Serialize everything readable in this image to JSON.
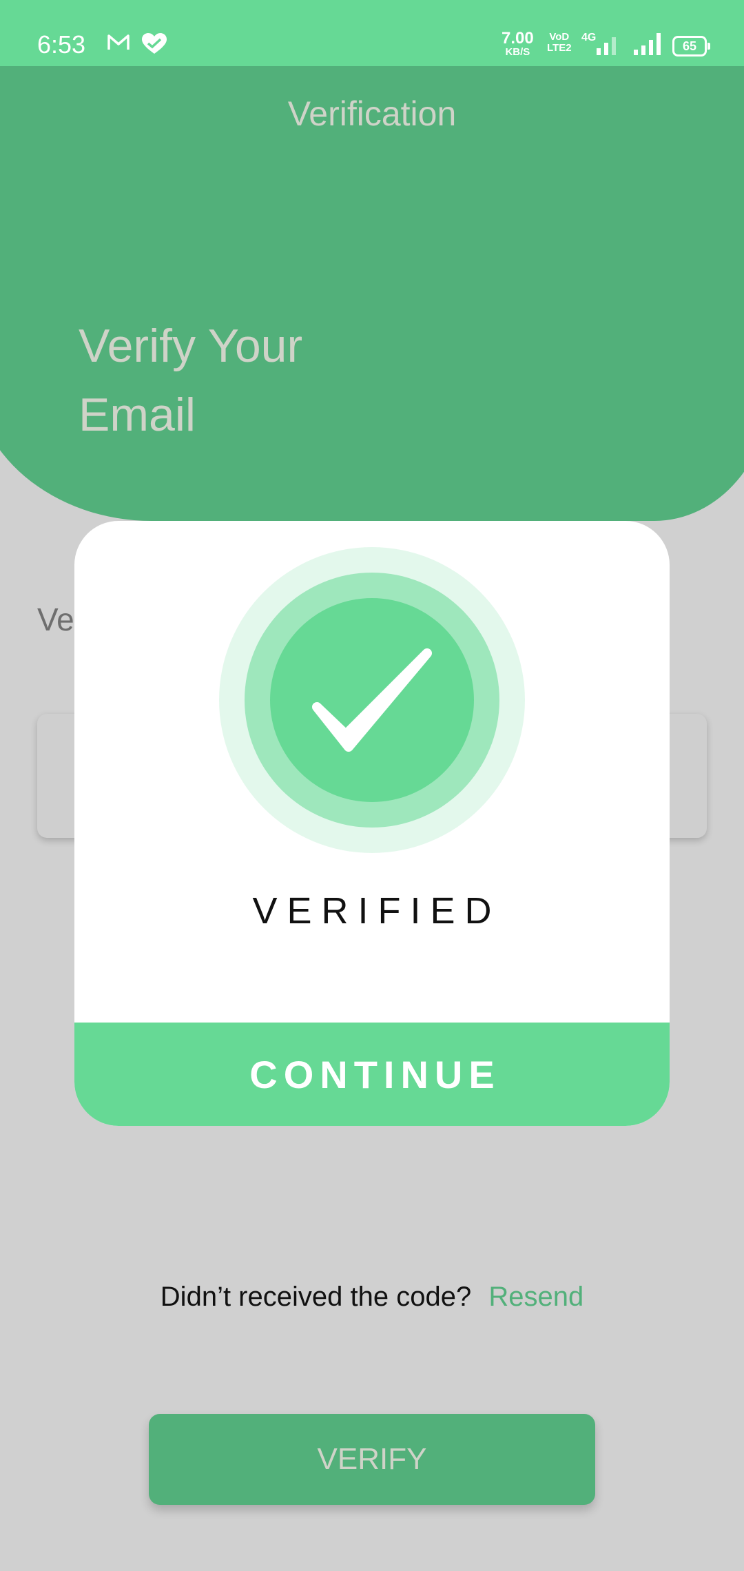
{
  "status_bar": {
    "time": "6:53",
    "net_speed_value": "7.00",
    "net_speed_unit": "KB/S",
    "volte_top": "VoD",
    "volte_bottom": "LTE2",
    "network_type": "4G",
    "battery": "65",
    "icons": [
      "gmail-icon",
      "health-heart-icon"
    ]
  },
  "header": {
    "title": "Verification",
    "hero_line1": "Verify Your",
    "hero_line2": "Email"
  },
  "background": {
    "label_partial": "Ve"
  },
  "dialog": {
    "status_text": "VERIFIED",
    "continue_label": "CONTINUE",
    "icon": "checkmark-icon"
  },
  "resend": {
    "prompt": "Didn’t received the code?",
    "link": "Resend"
  },
  "verify_button": {
    "label": "VERIFY"
  },
  "colors": {
    "primary_light": "#66d995",
    "primary_dark": "#52b07a",
    "overlay_bg": "#d0d0d0"
  }
}
